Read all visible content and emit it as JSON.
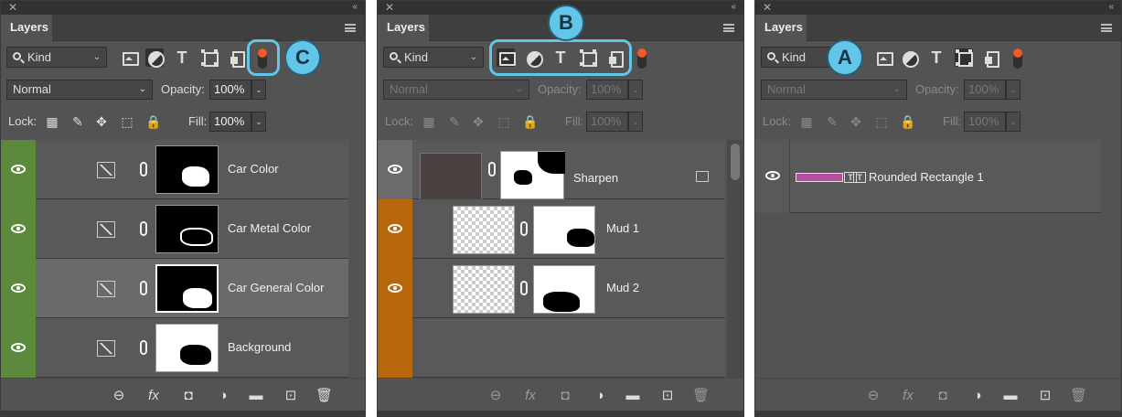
{
  "panels": [
    {
      "close": "✕",
      "collapse": "«",
      "tab": "Layers",
      "kind": "Kind",
      "blend_mode": "Normal",
      "opacity_label": "Opacity:",
      "opacity": "100%",
      "lock_label": "Lock:",
      "fill_label": "Fill:",
      "fill": "100%",
      "callout": "C",
      "layers": [
        {
          "name": "Car Color"
        },
        {
          "name": "Car Metal Color"
        },
        {
          "name": "Car General Color"
        },
        {
          "name": "Background"
        }
      ]
    },
    {
      "close": "✕",
      "collapse": "«",
      "tab": "Layers",
      "kind": "Kind",
      "blend_mode": "Normal",
      "opacity_label": "Opacity:",
      "opacity": "100%",
      "lock_label": "Lock:",
      "fill_label": "Fill:",
      "fill": "100%",
      "callout": "B",
      "layers": [
        {
          "name": "Sharpen"
        },
        {
          "name": "Mud 1"
        },
        {
          "name": "Mud 2"
        }
      ]
    },
    {
      "close": "✕",
      "collapse": "«",
      "tab": "Layers",
      "kind": "Kind",
      "blend_mode": "Normal",
      "opacity_label": "Opacity:",
      "opacity": "100%",
      "lock_label": "Lock:",
      "fill_label": "Fill:",
      "fill": "100%",
      "callout": "A",
      "layers": [
        {
          "name": "Rounded Rectangle 1"
        }
      ]
    }
  ],
  "glyphs": {
    "type_tool": "T",
    "chevron": "⌄",
    "fx": "fx",
    "rect_text": "T",
    "link": "⊖",
    "mask": "◘",
    "adjust": "◑",
    "folder": "▬",
    "new_layer": "⊡",
    "trash": "🗑"
  },
  "colors": {
    "eye_green": "#5b8a3c",
    "eye_orange": "#b8660c",
    "callout": "#62c6e8",
    "filter_toggle": "#f05a28",
    "shape_fill": "#b64fa0"
  }
}
